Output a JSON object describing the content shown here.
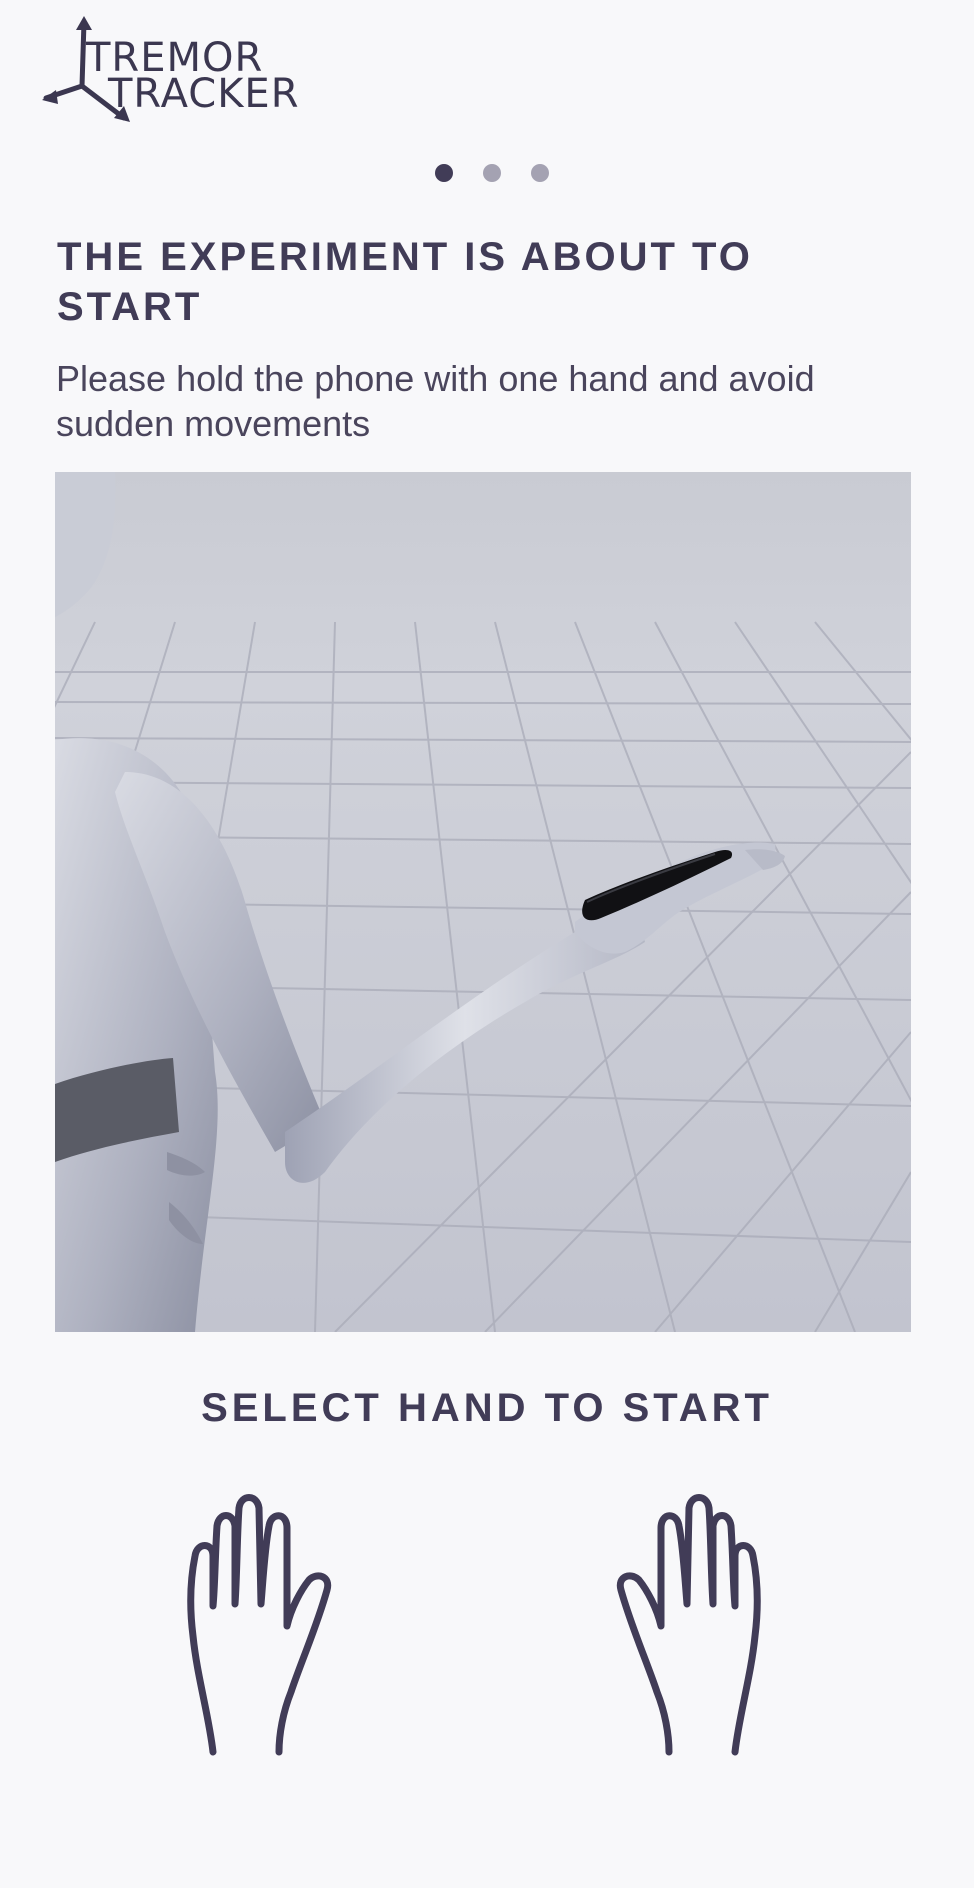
{
  "app": {
    "logo_line1": "TREMOR",
    "logo_line2": "TRACKER"
  },
  "pager": {
    "count": 3,
    "active": 0
  },
  "intro": {
    "title": "THE EXPERIMENT IS ABOUT TO START",
    "subtitle": "Please hold the phone with one hand and avoid sudden movements"
  },
  "illustration": {
    "icon": "person-holding-phone-illustration"
  },
  "hand_select": {
    "label": "SELECT HAND TO START",
    "options": [
      "left-hand-icon",
      "right-hand-icon"
    ]
  },
  "colors": {
    "accent": "#413c57",
    "background": "#f8f8fa",
    "dot_inactive": "#a4a2b2"
  }
}
